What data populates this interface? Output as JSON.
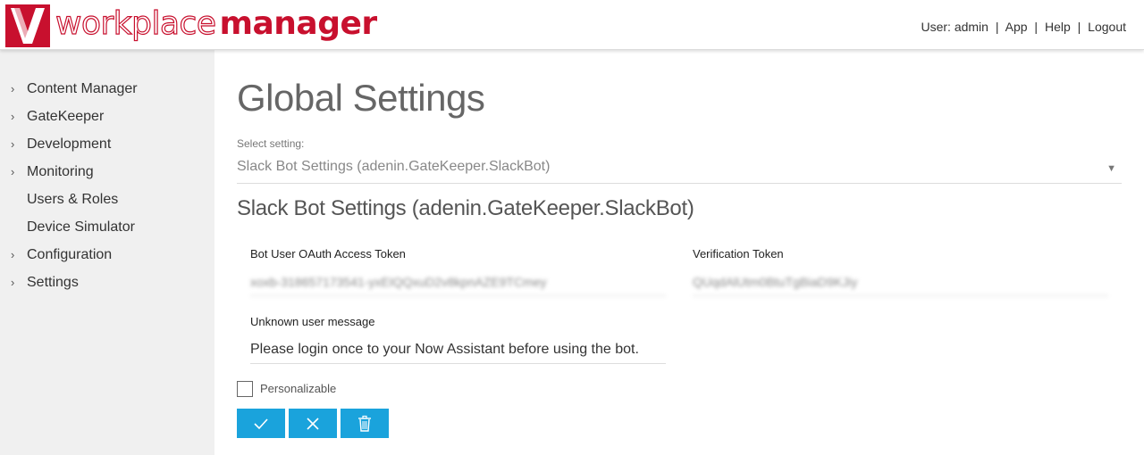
{
  "header": {
    "brand_light": "workplace",
    "brand_bold": "manager",
    "user_label": "User: admin",
    "links": [
      "App",
      "Help",
      "Logout"
    ],
    "brand_color": "#c8102e"
  },
  "sidebar": {
    "items": [
      {
        "label": "Content Manager",
        "expandable": true
      },
      {
        "label": "GateKeeper",
        "expandable": true
      },
      {
        "label": "Development",
        "expandable": true
      },
      {
        "label": "Monitoring",
        "expandable": true
      },
      {
        "label": "Users & Roles",
        "expandable": false
      },
      {
        "label": "Device Simulator",
        "expandable": false
      },
      {
        "label": "Configuration",
        "expandable": true
      },
      {
        "label": "Settings",
        "expandable": true
      }
    ],
    "chevron": "›"
  },
  "main": {
    "title": "Global Settings",
    "select_label": "Select setting:",
    "select_value": "Slack Bot Settings (adenin.GateKeeper.SlackBot)",
    "select_caret": "▼",
    "section_title": "Slack Bot Settings (adenin.GateKeeper.SlackBot)",
    "fields": {
      "bot_token": {
        "label": "Bot User OAuth Access Token",
        "value": "xoxb-318657173541-yxEIQQxuD2v8kpnAZE9TCmey"
      },
      "verification_token": {
        "label": "Verification Token",
        "value": "QUqdAlUtm0BtuTgBiaD9KJiy"
      },
      "unknown_user_message": {
        "label": "Unknown user message",
        "value": "Please login once to your Now Assistant before using the bot."
      }
    },
    "personalizable_label": "Personalizable",
    "personalizable_checked": false,
    "buttons": {
      "save_icon": "check-icon",
      "cancel_icon": "close-icon",
      "delete_icon": "trash-icon",
      "color": "#1aa3dc"
    }
  }
}
